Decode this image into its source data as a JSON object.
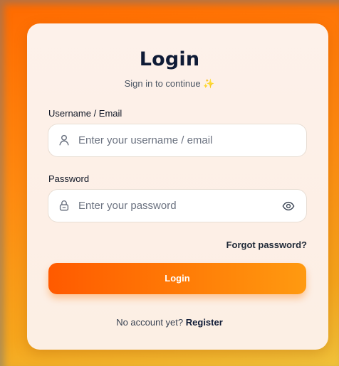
{
  "form": {
    "title": "Login",
    "subtitle": "Sign in to continue",
    "sparkle_icon": "sparkle-icon",
    "username_label": "Username / Email",
    "username_placeholder": "Enter your username / email",
    "username_icon": "user-icon",
    "password_label": "Password",
    "password_placeholder": "Enter your password",
    "password_icon": "lock-icon",
    "reveal_icon": "eye-icon",
    "forgot_label": "Forgot password?",
    "login_button_label": "Login",
    "register_prompt": "No account yet?",
    "register_label": "Register"
  },
  "colors": {
    "accent_start": "#ff5a00",
    "accent_end": "#ff9a10",
    "title_text": "#0f1b36"
  }
}
